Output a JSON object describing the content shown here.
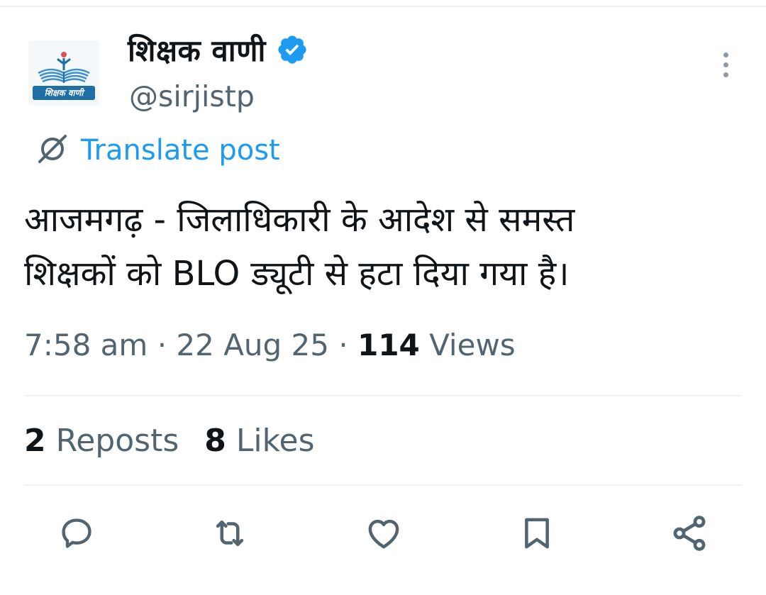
{
  "author": {
    "display_name": "शिक्षक वाणी",
    "handle": "@sirjistp",
    "avatar_text": "शिक्षक वाणी",
    "verified": true
  },
  "translate_label": "Translate post",
  "post": {
    "line1": "आजमगढ़ - जिलाधिकारी के आदेश से समस्त",
    "line2": "शिक्षकों को BLO ड्यूटी से हटा दिया गया है।"
  },
  "meta": {
    "time": "7:58 am",
    "separator": "·",
    "date": "22 Aug 25",
    "views_count": "114",
    "views_label": "Views"
  },
  "stats": {
    "reposts_count": "2",
    "reposts_label": "Reposts",
    "likes_count": "8",
    "likes_label": "Likes"
  },
  "actions": [
    "reply-icon",
    "repost-icon",
    "like-icon",
    "bookmark-icon",
    "share-icon"
  ],
  "colors": {
    "accent": "#1d9bf0",
    "text": "#0f1419",
    "muted": "#536471",
    "divider": "#eff3f4"
  }
}
